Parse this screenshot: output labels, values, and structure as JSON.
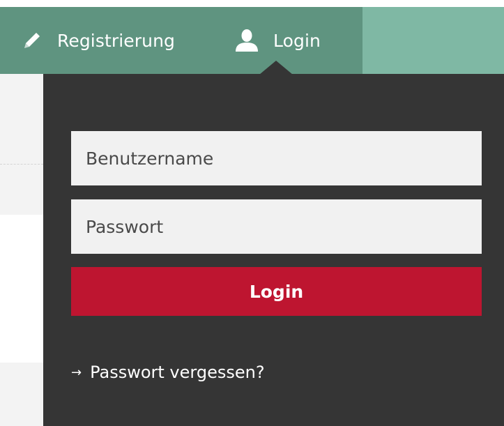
{
  "nav": {
    "register": {
      "label": "Registrierung",
      "icon": "pencil-icon"
    },
    "login": {
      "label": "Login",
      "icon": "user-icon"
    }
  },
  "login_form": {
    "username_placeholder": "Benutzername",
    "password_placeholder": "Passwort",
    "submit_label": "Login",
    "forgot_password_label": "Passwort vergessen?",
    "forgot_password_icon": "→"
  },
  "colors": {
    "nav_background": "#7fb8a4",
    "nav_group_background": "#5f9480",
    "dropdown_background": "#353535",
    "primary_button": "#be1530"
  }
}
